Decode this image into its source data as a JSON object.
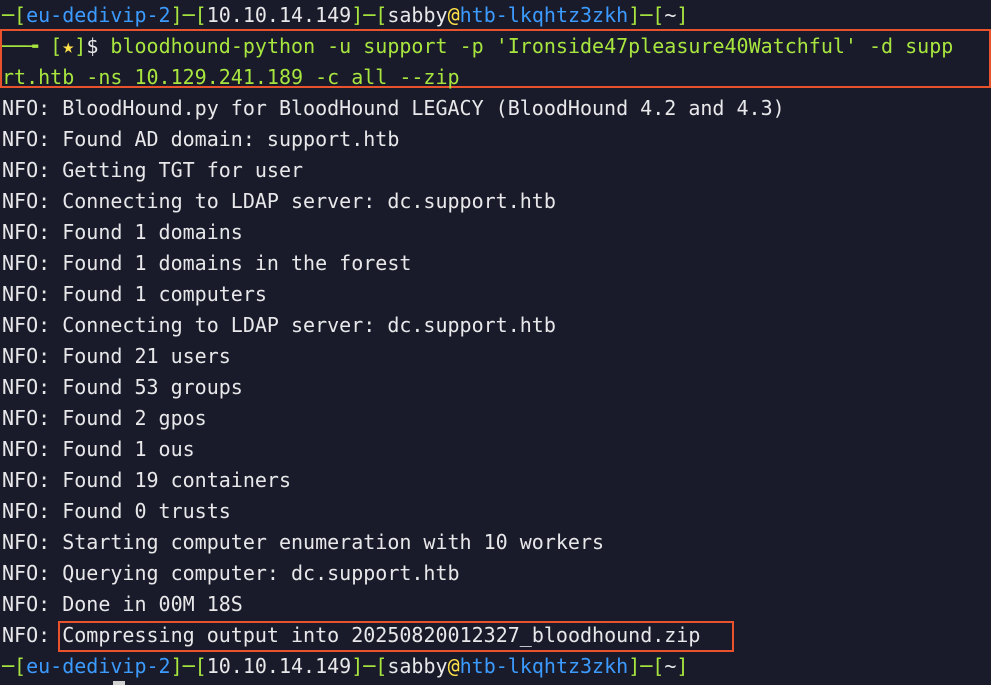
{
  "prompt": {
    "corner": "─",
    "host": "eu-dedivip-2",
    "ip": "10.10.14.149",
    "user": "sabby",
    "at": "@",
    "machine": "htb-lkqhtz3zkh",
    "dir": "~",
    "arrow": "──╼",
    "star": "★",
    "dollar": "$"
  },
  "command": {
    "line1": "bloodhound-python -u support -p 'Ironside47pleasure40Watchful' -d supp",
    "line2": "rt.htb -ns 10.129.241.189 -c all --zip"
  },
  "output": [
    "NFO: BloodHound.py for BloodHound LEGACY (BloodHound 4.2 and 4.3)",
    "NFO: Found AD domain: support.htb",
    "NFO: Getting TGT for user",
    "NFO: Connecting to LDAP server: dc.support.htb",
    "NFO: Found 1 domains",
    "NFO: Found 1 domains in the forest",
    "NFO: Found 1 computers",
    "NFO: Connecting to LDAP server: dc.support.htb",
    "NFO: Found 21 users",
    "NFO: Found 53 groups",
    "NFO: Found 2 gpos",
    "NFO: Found 1 ous",
    "NFO: Found 19 containers",
    "NFO: Found 0 trusts",
    "NFO: Starting computer enumeration with 10 workers",
    "NFO: Querying computer: dc.support.htb",
    "NFO: Done in 00M 18S"
  ],
  "final": {
    "prefix": "NFO: ",
    "message": "Compressing output into 20250820012327_bloodhound.zip"
  },
  "colors": {
    "background": "#191b2a",
    "green": "#a8e63f",
    "blue": "#3c9bff",
    "yellow": "#ffe14a",
    "highlight": "#e8532d"
  }
}
